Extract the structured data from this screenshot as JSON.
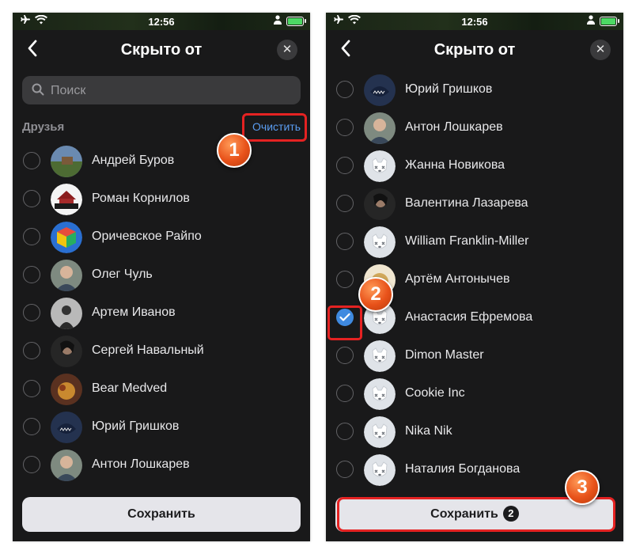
{
  "status_bar": {
    "time": "12:56"
  },
  "left_screen": {
    "title": "Скрыто от",
    "search": {
      "placeholder": "Поиск"
    },
    "section_title": "Друзья",
    "clear_label": "Очистить",
    "friends": [
      {
        "name": "Андрей Буров",
        "checked": false,
        "avatar": "photo-landscape"
      },
      {
        "name": "Роман Корнилов",
        "checked": false,
        "avatar": "building-logo"
      },
      {
        "name": "Оричевское Райпо",
        "checked": false,
        "avatar": "cube-logo"
      },
      {
        "name": "Олег Чуль",
        "checked": false,
        "avatar": "photo-person"
      },
      {
        "name": "Артем Иванов",
        "checked": false,
        "avatar": "photo-grey"
      },
      {
        "name": "Сергей Навальный",
        "checked": false,
        "avatar": "photo-dark"
      },
      {
        "name": "Bear Medved",
        "checked": false,
        "avatar": "photo-food"
      },
      {
        "name": "Юрий Гришков",
        "checked": false,
        "avatar": "photo-fish"
      },
      {
        "name": "Антон Лошкарев",
        "checked": false,
        "avatar": "photo-person"
      }
    ],
    "save_label": "Сохранить"
  },
  "right_screen": {
    "title": "Скрыто от",
    "friends": [
      {
        "name": "Юрий Гришков",
        "checked": false,
        "avatar": "photo-fish"
      },
      {
        "name": "Антон Лошкарев",
        "checked": false,
        "avatar": "photo-person"
      },
      {
        "name": "Жанна Новикова",
        "checked": false,
        "avatar": "default-dog"
      },
      {
        "name": "Валентина Лазарева",
        "checked": false,
        "avatar": "photo-dark"
      },
      {
        "name": "William Franklin-Miller",
        "checked": false,
        "avatar": "default-dog"
      },
      {
        "name": "Артём Антонычев",
        "checked": false,
        "avatar": "photo-animal"
      },
      {
        "name": "Анастасия Ефремова",
        "checked": true,
        "avatar": "default-dog"
      },
      {
        "name": "Dimon Master",
        "checked": false,
        "avatar": "default-dog"
      },
      {
        "name": "Cookie Inc",
        "checked": false,
        "avatar": "default-dog"
      },
      {
        "name": "Nika Nik",
        "checked": false,
        "avatar": "default-dog"
      },
      {
        "name": "Наталия Богданова",
        "checked": false,
        "avatar": "default-dog"
      }
    ],
    "save_label": "Сохранить",
    "save_count": "2"
  },
  "step_markers": [
    "1",
    "2",
    "3"
  ],
  "colors": {
    "accent": "#3f8ae0",
    "highlight": "#e52222",
    "marker": "#e8521a",
    "background": "#19191a"
  }
}
